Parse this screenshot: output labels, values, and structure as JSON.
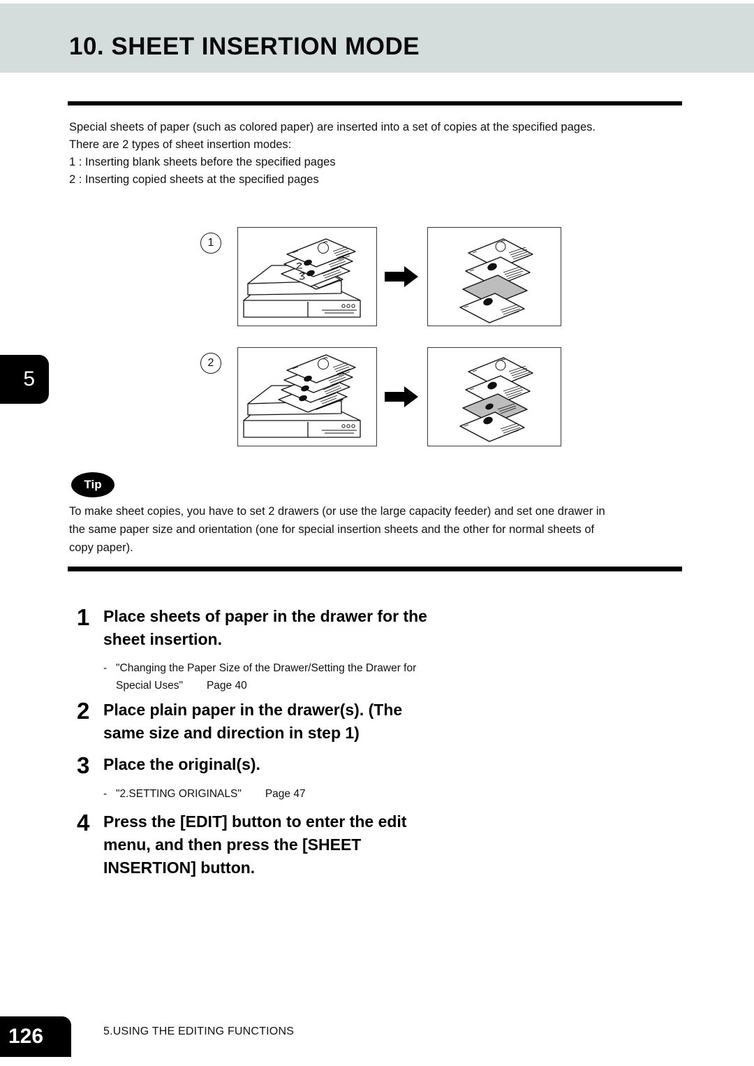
{
  "header": {
    "title": "10. SHEET INSERTION MODE",
    "band_color": "#d4dddb"
  },
  "chapter_tab": {
    "label": "5",
    "background": "#000000",
    "text_color": "#ffffff"
  },
  "intro": {
    "line1": "Special sheets of paper (such as colored paper) are inserted into a set of copies at the specified pages.",
    "line2": "There are 2 types of sheet insertion modes:",
    "line3": "1 : Inserting blank sheets before the specified pages",
    "line4": "2 : Inserting copied sheets at the specified pages"
  },
  "figures": [
    {
      "number": "1",
      "left_caption": "copier-with-three-originals",
      "arrow": "right-arrow-icon",
      "right_caption": "output-stack-with-blank-inserted-sheet"
    },
    {
      "number": "2",
      "left_caption": "copier-with-four-originals",
      "arrow": "right-arrow-icon",
      "right_caption": "output-stack-with-copied-inserted-sheet"
    }
  ],
  "tip": {
    "badge": "Tip",
    "line1": "To make sheet copies, you have to set 2 drawers (or use the large capacity feeder) and set one drawer in",
    "line2": "the same paper size and orientation (one for special insertion sheets and the other for normal sheets of",
    "line3": "copy paper)."
  },
  "steps": [
    {
      "num": "1",
      "lines": [
        "Place sheets of paper in the drawer for the",
        "sheet insertion."
      ],
      "note": {
        "dash": "-",
        "line1": "\"Changing the Paper Size of the Drawer/Setting the Drawer for",
        "line2_a": "Special Uses\"",
        "line2_b": "Page 40"
      }
    },
    {
      "num": "2",
      "lines": [
        "Place plain paper in the drawer(s). (The",
        "same size and direction in step 1)"
      ],
      "note": null
    },
    {
      "num": "3",
      "lines": [
        "Place the original(s)."
      ],
      "note": {
        "dash": "-",
        "line1": "",
        "line2_a": "\"2.SETTING ORIGINALS\"",
        "line2_b": "Page 47"
      }
    },
    {
      "num": "4",
      "lines": [
        "Press the [EDIT] button to enter the edit",
        "menu, and then press the [SHEET",
        "INSERTION] button."
      ],
      "note": null
    }
  ],
  "footer": {
    "page_number": "126",
    "section": "5.USING THE EDITING FUNCTIONS"
  }
}
